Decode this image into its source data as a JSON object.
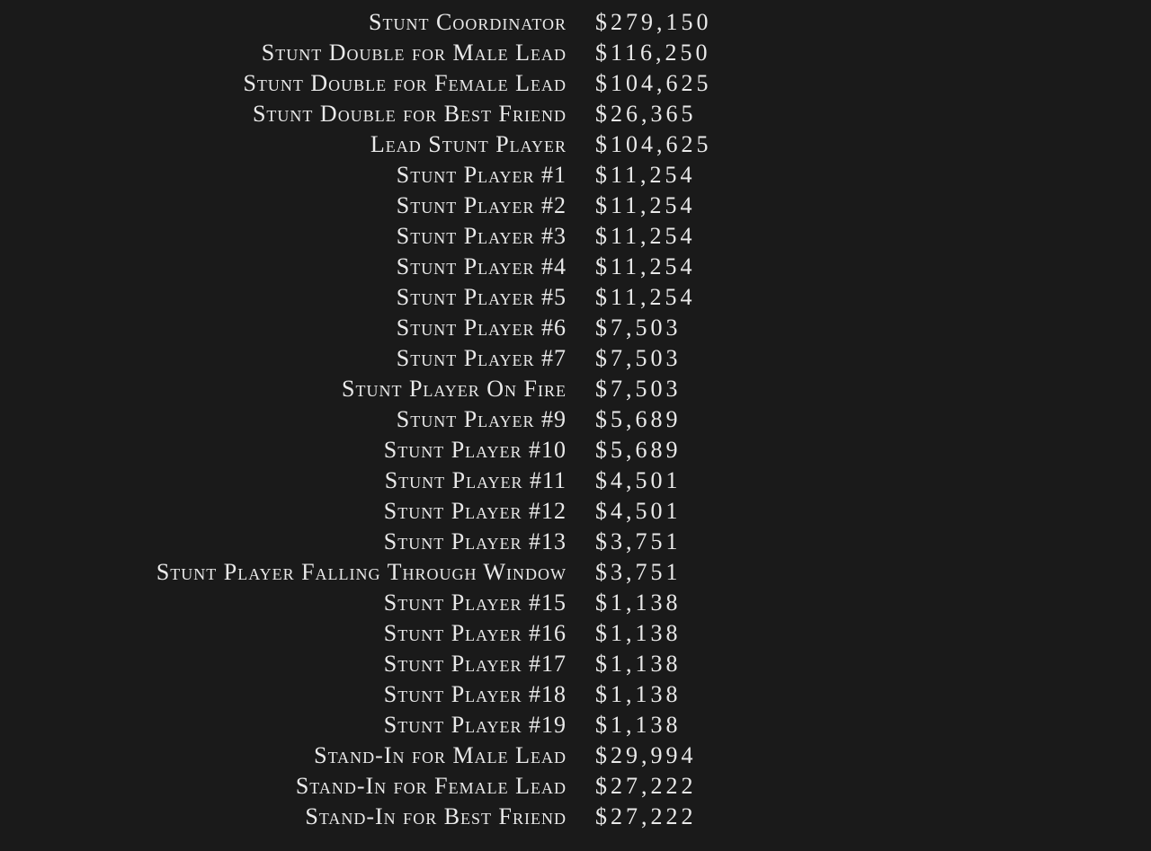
{
  "credits": [
    {
      "role": "Stunt Coordinator",
      "amount": "$279,150"
    },
    {
      "role": "Stunt Double for Male Lead",
      "amount": "$116,250"
    },
    {
      "role": "Stunt Double for Female Lead",
      "amount": "$104,625"
    },
    {
      "role": "Stunt Double for Best Friend",
      "amount": "$26,365"
    },
    {
      "role": "Lead Stunt Player",
      "amount": "$104,625"
    },
    {
      "role": "Stunt Player #1",
      "amount": "$11,254"
    },
    {
      "role": "Stunt Player #2",
      "amount": "$11,254"
    },
    {
      "role": "Stunt Player #3",
      "amount": "$11,254"
    },
    {
      "role": "Stunt Player #4",
      "amount": "$11,254"
    },
    {
      "role": "Stunt Player #5",
      "amount": "$11,254"
    },
    {
      "role": "Stunt Player #6",
      "amount": "$7,503"
    },
    {
      "role": "Stunt Player #7",
      "amount": "$7,503"
    },
    {
      "role": "Stunt Player On Fire",
      "amount": "$7,503"
    },
    {
      "role": "Stunt Player #9",
      "amount": "$5,689"
    },
    {
      "role": "Stunt Player #10",
      "amount": "$5,689"
    },
    {
      "role": "Stunt Player #11",
      "amount": "$4,501"
    },
    {
      "role": "Stunt Player #12",
      "amount": "$4,501"
    },
    {
      "role": "Stunt Player #13",
      "amount": "$3,751"
    },
    {
      "role": "Stunt Player Falling Through Window",
      "amount": "$3,751"
    },
    {
      "role": "Stunt Player #15",
      "amount": "$1,138"
    },
    {
      "role": "Stunt Player #16",
      "amount": "$1,138"
    },
    {
      "role": "Stunt Player #17",
      "amount": "$1,138"
    },
    {
      "role": "Stunt Player #18",
      "amount": "$1,138"
    },
    {
      "role": "Stunt Player #19",
      "amount": "$1,138"
    },
    {
      "role": "Stand-In for Male Lead",
      "amount": "$29,994"
    },
    {
      "role": "Stand-In for Female Lead",
      "amount": "$27,222"
    },
    {
      "role": "Stand-In for Best Friend",
      "amount": "$27,222"
    }
  ]
}
